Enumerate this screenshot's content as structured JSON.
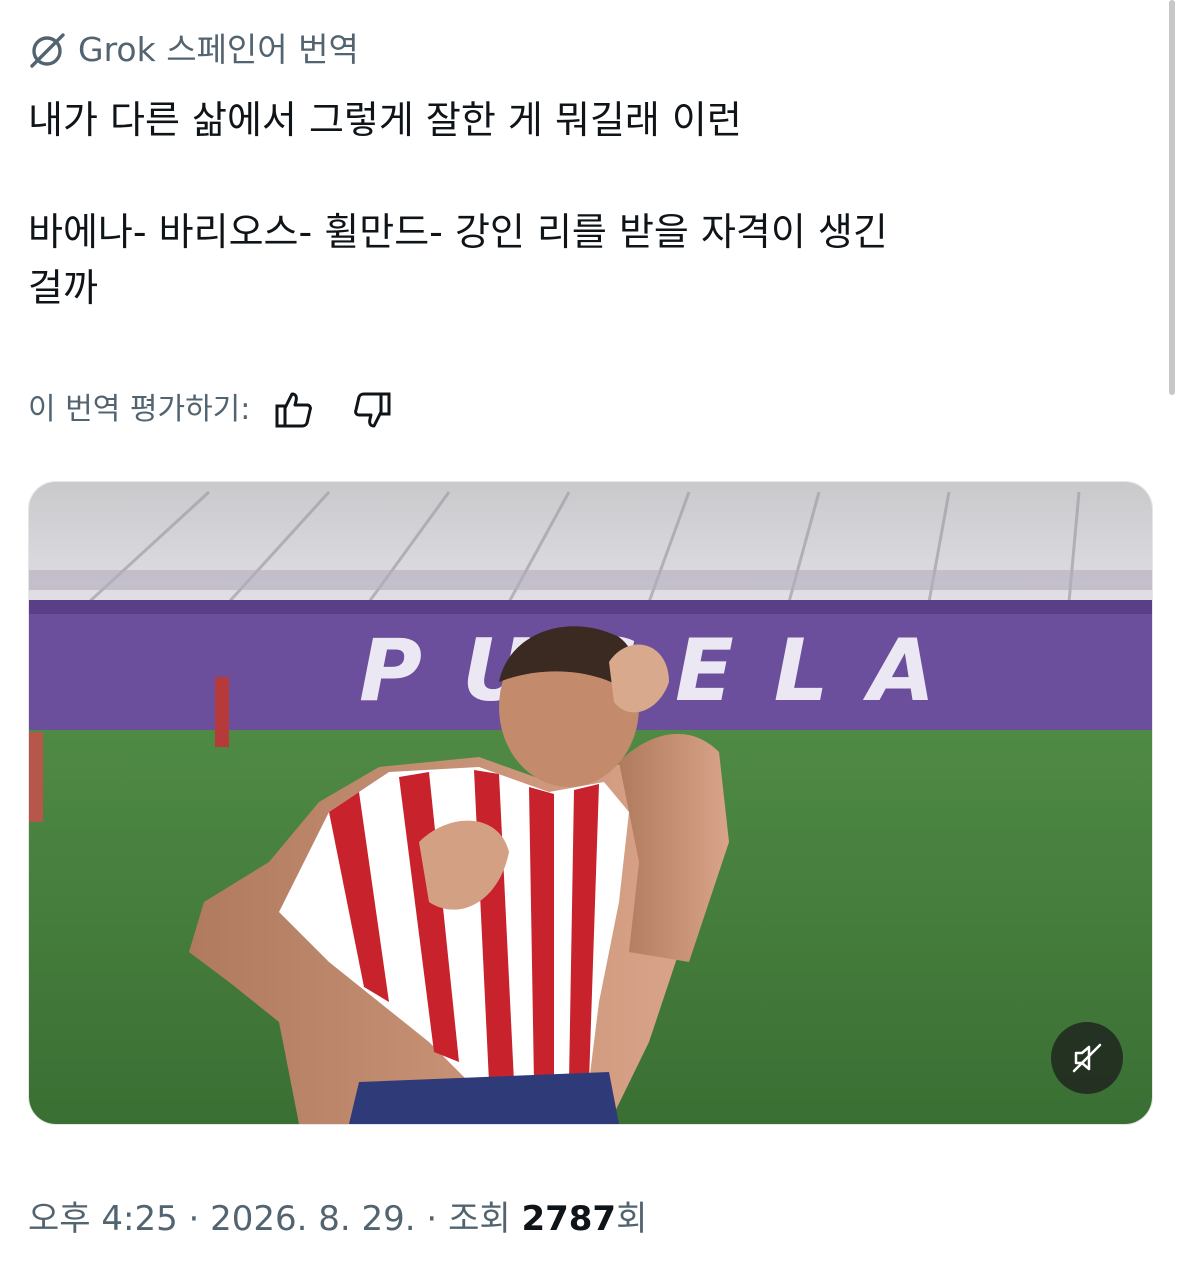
{
  "translation": {
    "header_label": "Grok 스페인어 번역",
    "icon": "grok-icon"
  },
  "tweet": {
    "lines": [
      "내가 다른 삶에서 그렇게 잘한 게 뭐길래 이런",
      "바에나- 바리오스- 휠만드- 강인 리를 받을 자격이 생긴",
      "걸까"
    ]
  },
  "rating": {
    "label": "이 번역 평가하기:",
    "thumbs_up_icon": "thumbs-up-icon",
    "thumbs_down_icon": "thumbs-down-icon"
  },
  "media": {
    "type": "video",
    "stadium_sign_text": "PUCELA",
    "mute_icon": "speaker-muted-icon",
    "colors": {
      "pitch": "#3f7a3a",
      "board": "#6a4d9a",
      "jersey_red": "#c8232c"
    }
  },
  "meta": {
    "time": "오후 4:25",
    "separator": " · ",
    "date": "2026. 8. 29.",
    "views_prefix": "조회 ",
    "views_count": "2787",
    "views_suffix": "회"
  }
}
